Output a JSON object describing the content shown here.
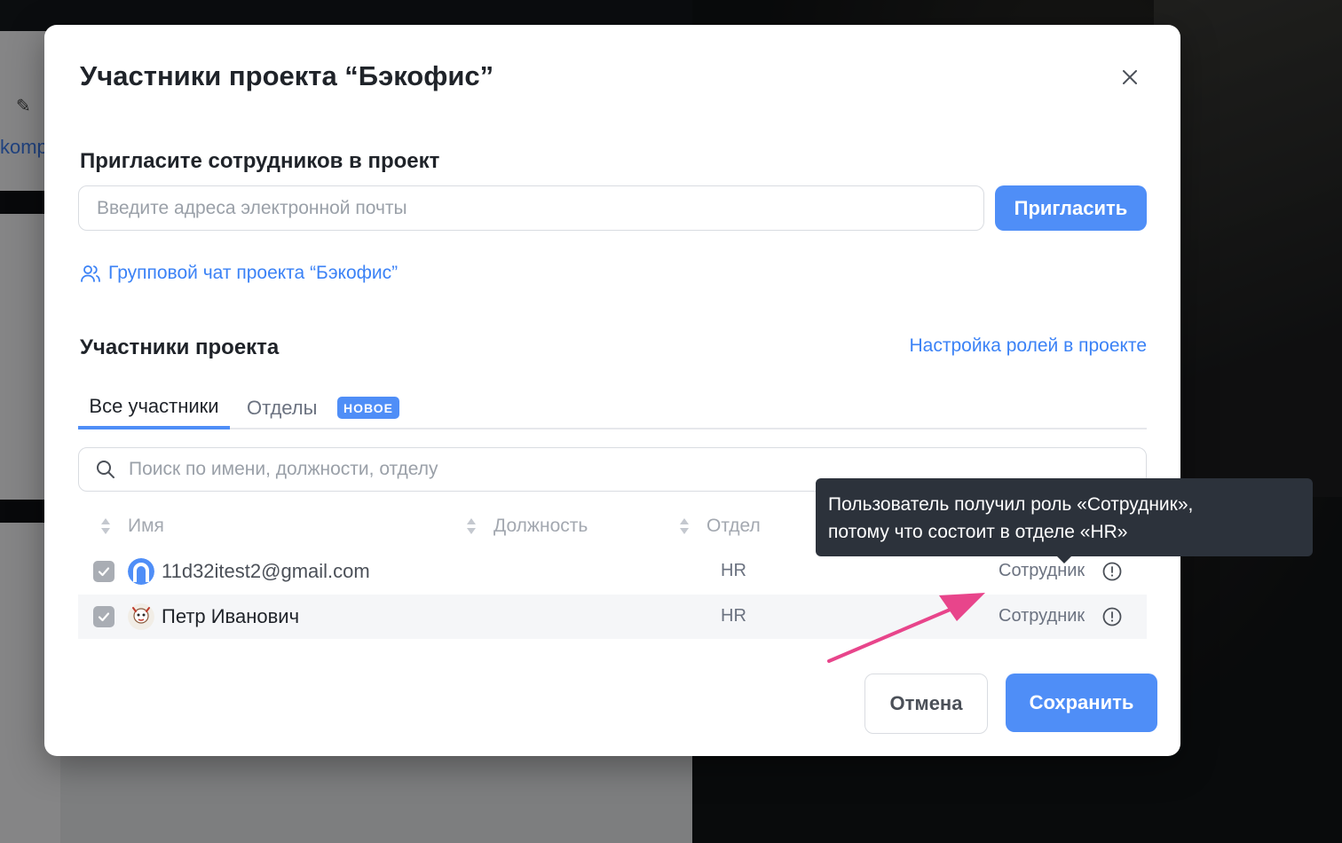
{
  "modal": {
    "title": "Участники проекта “Бэкофис”",
    "invite_section_title": "Пригласите сотрудников в проект",
    "email_placeholder": "Введите адреса электронной почты",
    "invite_button": "Пригласить",
    "group_chat_link": "Групповой чат проекта “Бэкофис”",
    "members_title": "Участники проекта",
    "roles_link": "Настройка ролей в проекте"
  },
  "tabs": [
    {
      "label": "Все участники",
      "active": true
    },
    {
      "label": "Отделы",
      "active": false
    }
  ],
  "badge_new": "НОВОЕ",
  "search": {
    "placeholder": "Поиск по имени, должности, отделу"
  },
  "table": {
    "columns": [
      "Имя",
      "Должность",
      "Отдел"
    ],
    "rows": [
      {
        "name": "11d32itest2@gmail.com",
        "department": "HR",
        "role": "Сотрудник",
        "checked": true
      },
      {
        "name": "Петр Иванович",
        "department": "HR",
        "role": "Сотрудник",
        "checked": true
      }
    ]
  },
  "tooltip": {
    "line1": "Пользователь получил роль «Сотрудник»,",
    "line2": "потому что состоит в отделе «HR»"
  },
  "footer": {
    "cancel": "Отмена",
    "save": "Сохранить"
  },
  "background": {
    "partial_link_text": "komp"
  },
  "colors": {
    "accent": "#4f8ef7",
    "link": "#3b82f6",
    "annotation_arrow": "#e8458b",
    "tooltip_bg": "#2c323b"
  }
}
